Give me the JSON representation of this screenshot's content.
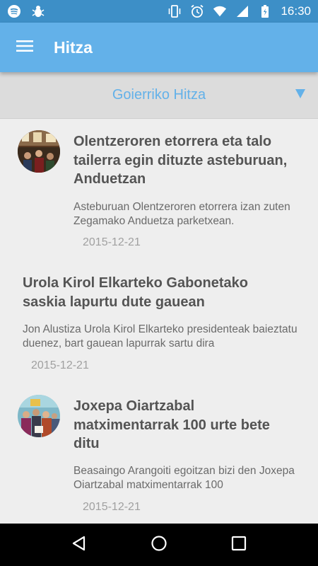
{
  "status_bar": {
    "time": "16:30",
    "icons": [
      "spotify-icon",
      "bug-icon",
      "vibrate-icon",
      "alarm-icon",
      "wifi-icon",
      "signal-icon",
      "battery-icon"
    ]
  },
  "app_bar": {
    "title": "Hitza",
    "menu_icon": "hamburger-menu-icon"
  },
  "source_selector": {
    "selected": "Goierriko Hitza",
    "arrow_icon": "dropdown-triangle-icon"
  },
  "articles": [
    {
      "title": "Olentzeroren etorrera eta talo tailerra egin dituzte asteburuan, Anduetzan",
      "description": "Asteburuan Olentzeroren etorrera izan zuten Zegamako Anduetza parketxean.",
      "date": "2015-12-21",
      "has_thumbnail": true
    },
    {
      "title": "Urola Kirol Elkarteko Gabonetako saskia lapurtu dute gauean",
      "description": "Jon Alustiza Urola Kirol Elkarteko presidenteak baieztatu duenez, bart gauean lapurrak sartu dira",
      "date": "2015-12-21",
      "has_thumbnail": false
    },
    {
      "title": "Joxepa Oiartzabal matximentarrak 100 urte bete ditu",
      "description": "Beasaingo Arangoiti egoitzan bizi den Joxepa Oiartzabal matximentarrak 100",
      "date": "2015-12-21",
      "has_thumbnail": true
    }
  ],
  "nav_bar": {
    "buttons": [
      "back-icon",
      "home-icon",
      "recents-icon"
    ]
  },
  "colors": {
    "status_bar": "#3d8fc7",
    "app_bar": "#63b1e9",
    "accent": "#63b1e9",
    "background": "#eeeeee"
  }
}
